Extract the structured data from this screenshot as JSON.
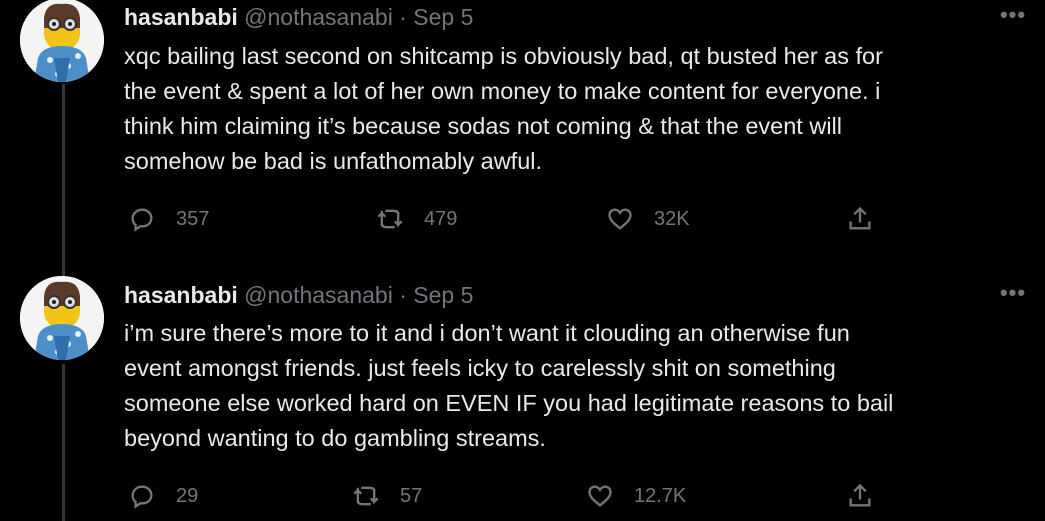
{
  "tweets": [
    {
      "name": "hasanbabi",
      "handle": "@nothasanabi",
      "separator": "·",
      "date": "Sep 5",
      "more": "•••",
      "text": "xqc bailing last second on shitcamp is obviously bad, qt busted her as   for\nthe event & spent a lot of her own money to make content for everyone. i\nthink him claiming it’s because sodas not coming & that the event will\nsomehow be bad is unfathomably awful.",
      "replies": "357",
      "retweets": "479",
      "likes": "32K"
    },
    {
      "name": "hasanbabi",
      "handle": "@nothasanabi",
      "separator": "·",
      "date": "Sep 5",
      "more": "•••",
      "text": "i’m sure there’s more to it and i don’t want it clouding an otherwise fun\nevent amongst friends. just feels icky to carelessly shit on something\nsomeone else worked hard on EVEN IF you had legitimate reasons to bail\nbeyond wanting to do gambling streams.",
      "replies": "29",
      "retweets": "57",
      "likes": "12.7K"
    }
  ],
  "icons": {
    "reply": "reply-icon",
    "retweet": "retweet-icon",
    "like": "heart-icon",
    "share": "share-icon"
  },
  "colors": {
    "background": "#000000",
    "text": "#e7e9ea",
    "muted": "#71767b",
    "thread_line": "#333639"
  }
}
